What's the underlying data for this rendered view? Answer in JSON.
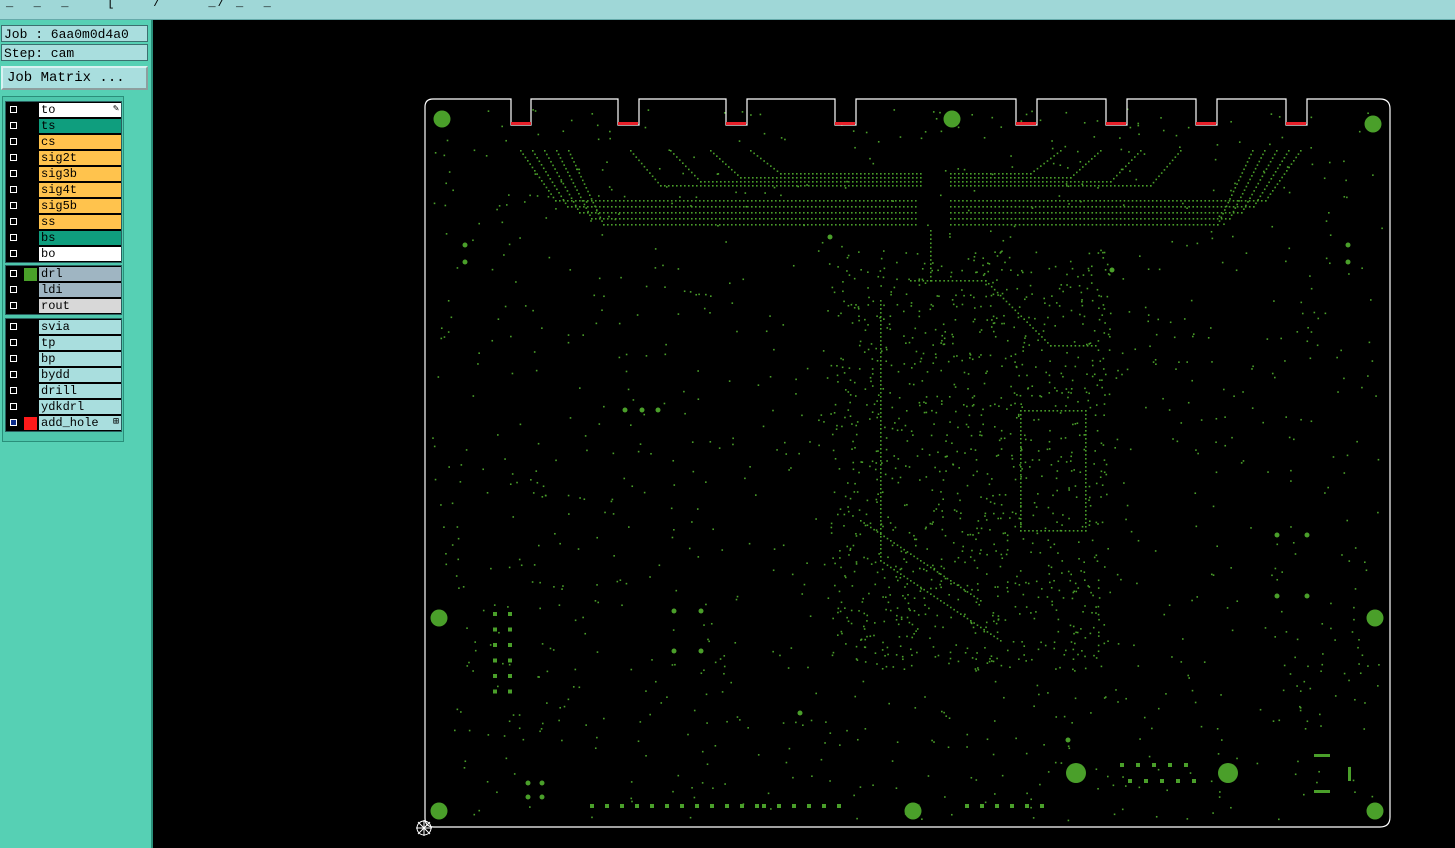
{
  "job_label": "Job : 6aa0m0d4a0",
  "step_label": "Step: cam",
  "job_matrix_button": "Job Matrix ...",
  "colors": {
    "sidebar": "#56d0b4",
    "board": "#4a9f2a",
    "outline": "#ffffff",
    "finger_tips": "#e8202a"
  },
  "layer_groups": [
    {
      "layers": [
        {
          "name": "to",
          "bg": "#ffffff",
          "swatch": "",
          "checked": false,
          "mark": "pencil-icon"
        },
        {
          "name": "ts",
          "bg": "#0f9e7e",
          "swatch": "",
          "checked": false
        },
        {
          "name": "cs",
          "bg": "#ffc34d",
          "swatch": "",
          "checked": false
        },
        {
          "name": "sig2t",
          "bg": "#ffc34d",
          "swatch": "",
          "checked": false
        },
        {
          "name": "sig3b",
          "bg": "#ffc34d",
          "swatch": "",
          "checked": false
        },
        {
          "name": "sig4t",
          "bg": "#ffc34d",
          "swatch": "",
          "checked": false
        },
        {
          "name": "sig5b",
          "bg": "#ffc34d",
          "swatch": "",
          "checked": false
        },
        {
          "name": "ss",
          "bg": "#ffc34d",
          "swatch": "",
          "checked": false
        },
        {
          "name": "bs",
          "bg": "#0f9e7e",
          "swatch": "",
          "checked": false
        },
        {
          "name": "bo",
          "bg": "#ffffff",
          "swatch": "",
          "checked": false
        }
      ]
    },
    {
      "layers": [
        {
          "name": "drl",
          "bg": "#9fb5c2",
          "swatch": "#4aa02a",
          "checked": false
        },
        {
          "name": "ldi",
          "bg": "#9fb5c2",
          "swatch": "",
          "checked": false
        },
        {
          "name": "rout",
          "bg": "#d8d8d8",
          "swatch": "",
          "checked": false
        }
      ]
    },
    {
      "layers": [
        {
          "name": "svia",
          "bg": "#a9dede",
          "swatch": "",
          "checked": false
        },
        {
          "name": "tp",
          "bg": "#a9dede",
          "swatch": "",
          "checked": false
        },
        {
          "name": "bp",
          "bg": "#a9dede",
          "swatch": "",
          "checked": false
        },
        {
          "name": "bydd",
          "bg": "#a9dede",
          "swatch": "",
          "checked": false
        },
        {
          "name": "drill",
          "bg": "#a9dede",
          "swatch": "",
          "checked": false
        },
        {
          "name": "ydkdrl",
          "bg": "#a9dede",
          "swatch": "",
          "checked": false
        },
        {
          "name": "add_hole",
          "bg": "#a9dede",
          "swatch": "#ff1a1a",
          "checked": true,
          "mark": "grid-icon"
        }
      ]
    }
  ]
}
